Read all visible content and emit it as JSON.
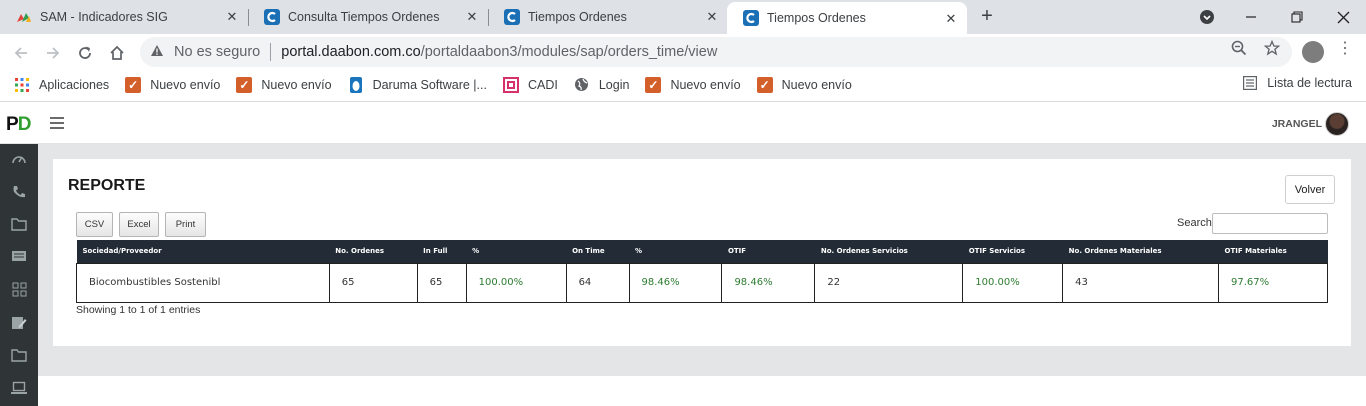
{
  "browser": {
    "tabs": [
      {
        "title": "SAM - Indicadores SIG",
        "icon": "sam-icon"
      },
      {
        "title": "Consulta Tiempos Ordenes",
        "icon": "c-app-icon"
      },
      {
        "title": "Tiempos Ordenes",
        "icon": "c-app-icon"
      },
      {
        "title": "Tiempos Ordenes",
        "icon": "c-app-icon",
        "active": true
      }
    ],
    "new_tab": "+",
    "security_text": "No es seguro",
    "url_host": "portal.daabon.com.co",
    "url_path": "/portaldaabon3/modules/sap/orders_time/view",
    "bookmarks": [
      {
        "label": "Aplicaciones",
        "icon": "apps-grid-icon"
      },
      {
        "label": "Nuevo envío",
        "icon": "checkbox-icon"
      },
      {
        "label": "Nuevo envío",
        "icon": "checkbox-icon"
      },
      {
        "label": "Daruma Software |...",
        "icon": "daruma-icon"
      },
      {
        "label": "CADI",
        "icon": "cadi-icon"
      },
      {
        "label": "Login",
        "icon": "globe-icon"
      },
      {
        "label": "Nuevo envío",
        "icon": "checkbox-icon"
      },
      {
        "label": "Nuevo envío",
        "icon": "checkbox-icon"
      }
    ],
    "reading_list": "Lista de lectura"
  },
  "app": {
    "logo_p": "P",
    "logo_d": "D",
    "user": "JRANGEL"
  },
  "report": {
    "title": "REPORTE",
    "back_button": "Volver",
    "export_buttons": [
      "CSV",
      "Excel",
      "Print"
    ],
    "search_label": "Search:",
    "search_value": "",
    "columns": [
      "Sociedad/Proveedor",
      "No. Ordenes",
      "In Full",
      "%",
      "On Time",
      "%",
      "OTIF",
      "No. Ordenes Servicios",
      "OTIF Servicios",
      "No. Ordenes Materiales",
      "OTIF Materiales"
    ],
    "rows": [
      [
        "Biocombustibles Sostenibl",
        "65",
        "65",
        "100.00%",
        "64",
        "98.46%",
        "98.46%",
        "22",
        "100.00%",
        "43",
        "97.67%"
      ]
    ],
    "info": "Showing 1 to 1 of 1 entries"
  },
  "colors": {
    "header_bg": "#232c36",
    "percent_green": "#2e7d32",
    "sidebar_bg": "#2f3436",
    "logo_green": "#2f9e2f"
  }
}
